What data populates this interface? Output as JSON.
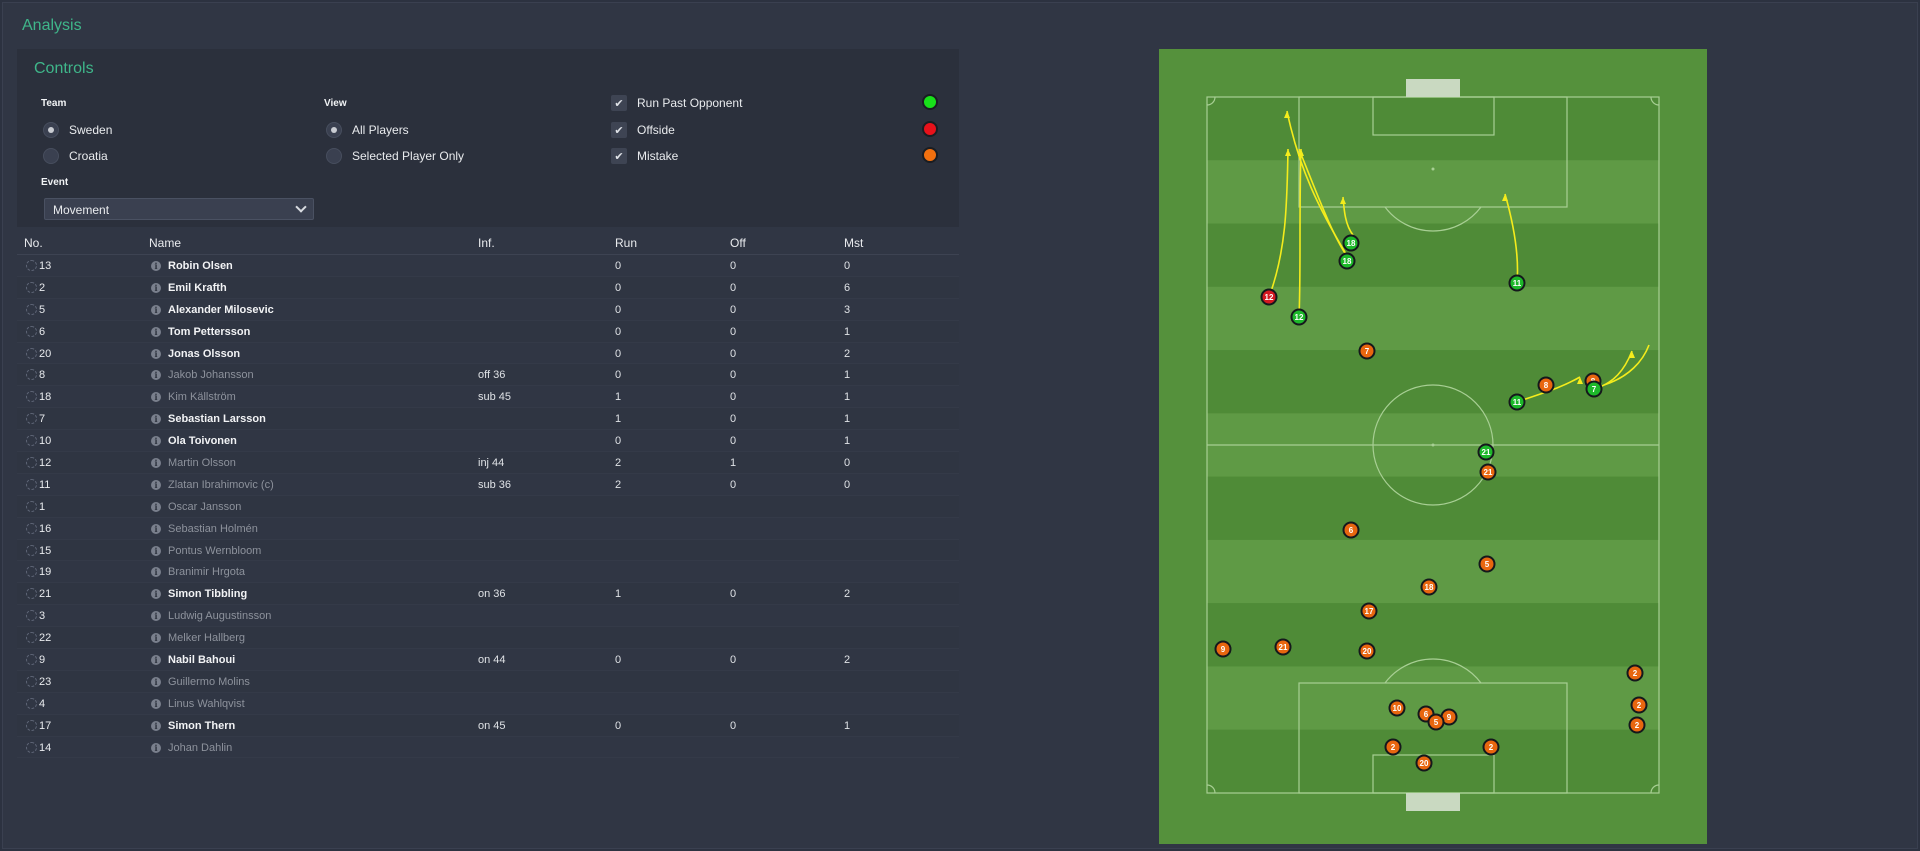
{
  "app": {
    "title": "Analysis"
  },
  "controls": {
    "title": "Controls",
    "team_label": "Team",
    "teams": [
      {
        "label": "Sweden",
        "selected": true
      },
      {
        "label": "Croatia",
        "selected": false
      }
    ],
    "view_label": "View",
    "views": [
      {
        "label": "All Players",
        "selected": true
      },
      {
        "label": "Selected Player Only",
        "selected": false
      }
    ],
    "filters": [
      {
        "label": "Run Past Opponent",
        "checked": true,
        "color": "#18e01a"
      },
      {
        "label": "Offside",
        "checked": true,
        "color": "#e8111a"
      },
      {
        "label": "Mistake",
        "checked": true,
        "color": "#f2700f"
      }
    ],
    "event_label": "Event",
    "event_value": "Movement"
  },
  "table": {
    "headers": {
      "no": "No.",
      "name": "Name",
      "inf": "Inf.",
      "run": "Run",
      "off": "Off",
      "mst": "Mst"
    },
    "rows": [
      {
        "no": "13",
        "name": "Robin Olsen",
        "inf": "",
        "run": "0",
        "off": "0",
        "mst": "0",
        "active": true
      },
      {
        "no": "2",
        "name": "Emil Krafth",
        "inf": "",
        "run": "0",
        "off": "0",
        "mst": "6",
        "active": true
      },
      {
        "no": "5",
        "name": "Alexander Milosevic",
        "inf": "",
        "run": "0",
        "off": "0",
        "mst": "3",
        "active": true
      },
      {
        "no": "6",
        "name": "Tom Pettersson",
        "inf": "",
        "run": "0",
        "off": "0",
        "mst": "1",
        "active": true
      },
      {
        "no": "20",
        "name": "Jonas Olsson",
        "inf": "",
        "run": "0",
        "off": "0",
        "mst": "2",
        "active": true
      },
      {
        "no": "8",
        "name": "Jakob Johansson",
        "inf": "off 36",
        "run": "0",
        "off": "0",
        "mst": "1",
        "active": false
      },
      {
        "no": "18",
        "name": "Kim Källström",
        "inf": "sub 45",
        "run": "1",
        "off": "0",
        "mst": "1",
        "active": false
      },
      {
        "no": "7",
        "name": "Sebastian Larsson",
        "inf": "",
        "run": "1",
        "off": "0",
        "mst": "1",
        "active": true
      },
      {
        "no": "10",
        "name": "Ola Toivonen",
        "inf": "",
        "run": "0",
        "off": "0",
        "mst": "1",
        "active": true
      },
      {
        "no": "12",
        "name": "Martin Olsson",
        "inf": "inj 44",
        "run": "2",
        "off": "1",
        "mst": "0",
        "active": false
      },
      {
        "no": "11",
        "name": "Zlatan Ibrahimovic (c)",
        "inf": "sub 36",
        "run": "2",
        "off": "0",
        "mst": "0",
        "active": false
      },
      {
        "no": "1",
        "name": "Oscar Jansson",
        "inf": "",
        "run": "",
        "off": "",
        "mst": "",
        "active": false
      },
      {
        "no": "16",
        "name": "Sebastian Holmén",
        "inf": "",
        "run": "",
        "off": "",
        "mst": "",
        "active": false
      },
      {
        "no": "15",
        "name": "Pontus Wernbloom",
        "inf": "",
        "run": "",
        "off": "",
        "mst": "",
        "active": false
      },
      {
        "no": "19",
        "name": "Branimir Hrgota",
        "inf": "",
        "run": "",
        "off": "",
        "mst": "",
        "active": false
      },
      {
        "no": "21",
        "name": "Simon Tibbling",
        "inf": "on 36",
        "run": "1",
        "off": "0",
        "mst": "2",
        "active": true
      },
      {
        "no": "3",
        "name": "Ludwig Augustinsson",
        "inf": "",
        "run": "",
        "off": "",
        "mst": "",
        "active": false
      },
      {
        "no": "22",
        "name": "Melker Hallberg",
        "inf": "",
        "run": "",
        "off": "",
        "mst": "",
        "active": false
      },
      {
        "no": "9",
        "name": "Nabil Bahoui",
        "inf": "on 44",
        "run": "0",
        "off": "0",
        "mst": "2",
        "active": true
      },
      {
        "no": "23",
        "name": "Guillermo Molins",
        "inf": "",
        "run": "",
        "off": "",
        "mst": "",
        "active": false
      },
      {
        "no": "4",
        "name": "Linus Wahlqvist",
        "inf": "",
        "run": "",
        "off": "",
        "mst": "",
        "active": false
      },
      {
        "no": "17",
        "name": "Simon Thern",
        "inf": "on 45",
        "run": "0",
        "off": "0",
        "mst": "1",
        "active": true
      },
      {
        "no": "14",
        "name": "Johan Dahlin",
        "inf": "",
        "run": "",
        "off": "",
        "mst": "",
        "active": false
      }
    ]
  },
  "pitch": {
    "markers": [
      {
        "n": "18",
        "kind": "run"
      },
      {
        "n": "18",
        "kind": "run"
      },
      {
        "n": "11",
        "kind": "run"
      },
      {
        "n": "12",
        "kind": "offside"
      },
      {
        "n": "12",
        "kind": "run"
      },
      {
        "n": "7",
        "kind": "mistake"
      },
      {
        "n": "8",
        "kind": "mistake"
      },
      {
        "n": "8",
        "kind": "mistake"
      },
      {
        "n": "7",
        "kind": "run"
      },
      {
        "n": "11",
        "kind": "run"
      },
      {
        "n": "21",
        "kind": "run"
      },
      {
        "n": "21",
        "kind": "mistake"
      },
      {
        "n": "6",
        "kind": "mistake"
      },
      {
        "n": "5",
        "kind": "mistake"
      },
      {
        "n": "18",
        "kind": "mistake"
      },
      {
        "n": "17",
        "kind": "mistake"
      },
      {
        "n": "9",
        "kind": "mistake"
      },
      {
        "n": "21",
        "kind": "mistake"
      },
      {
        "n": "20",
        "kind": "mistake"
      },
      {
        "n": "2",
        "kind": "mistake"
      },
      {
        "n": "10",
        "kind": "mistake"
      },
      {
        "n": "6",
        "kind": "mistake"
      },
      {
        "n": "9",
        "kind": "mistake"
      },
      {
        "n": "5",
        "kind": "mistake"
      },
      {
        "n": "2",
        "kind": "mistake"
      },
      {
        "n": "2",
        "kind": "mistake"
      },
      {
        "n": "2",
        "kind": "mistake"
      },
      {
        "n": "2",
        "kind": "mistake"
      },
      {
        "n": "20",
        "kind": "mistake"
      }
    ]
  }
}
